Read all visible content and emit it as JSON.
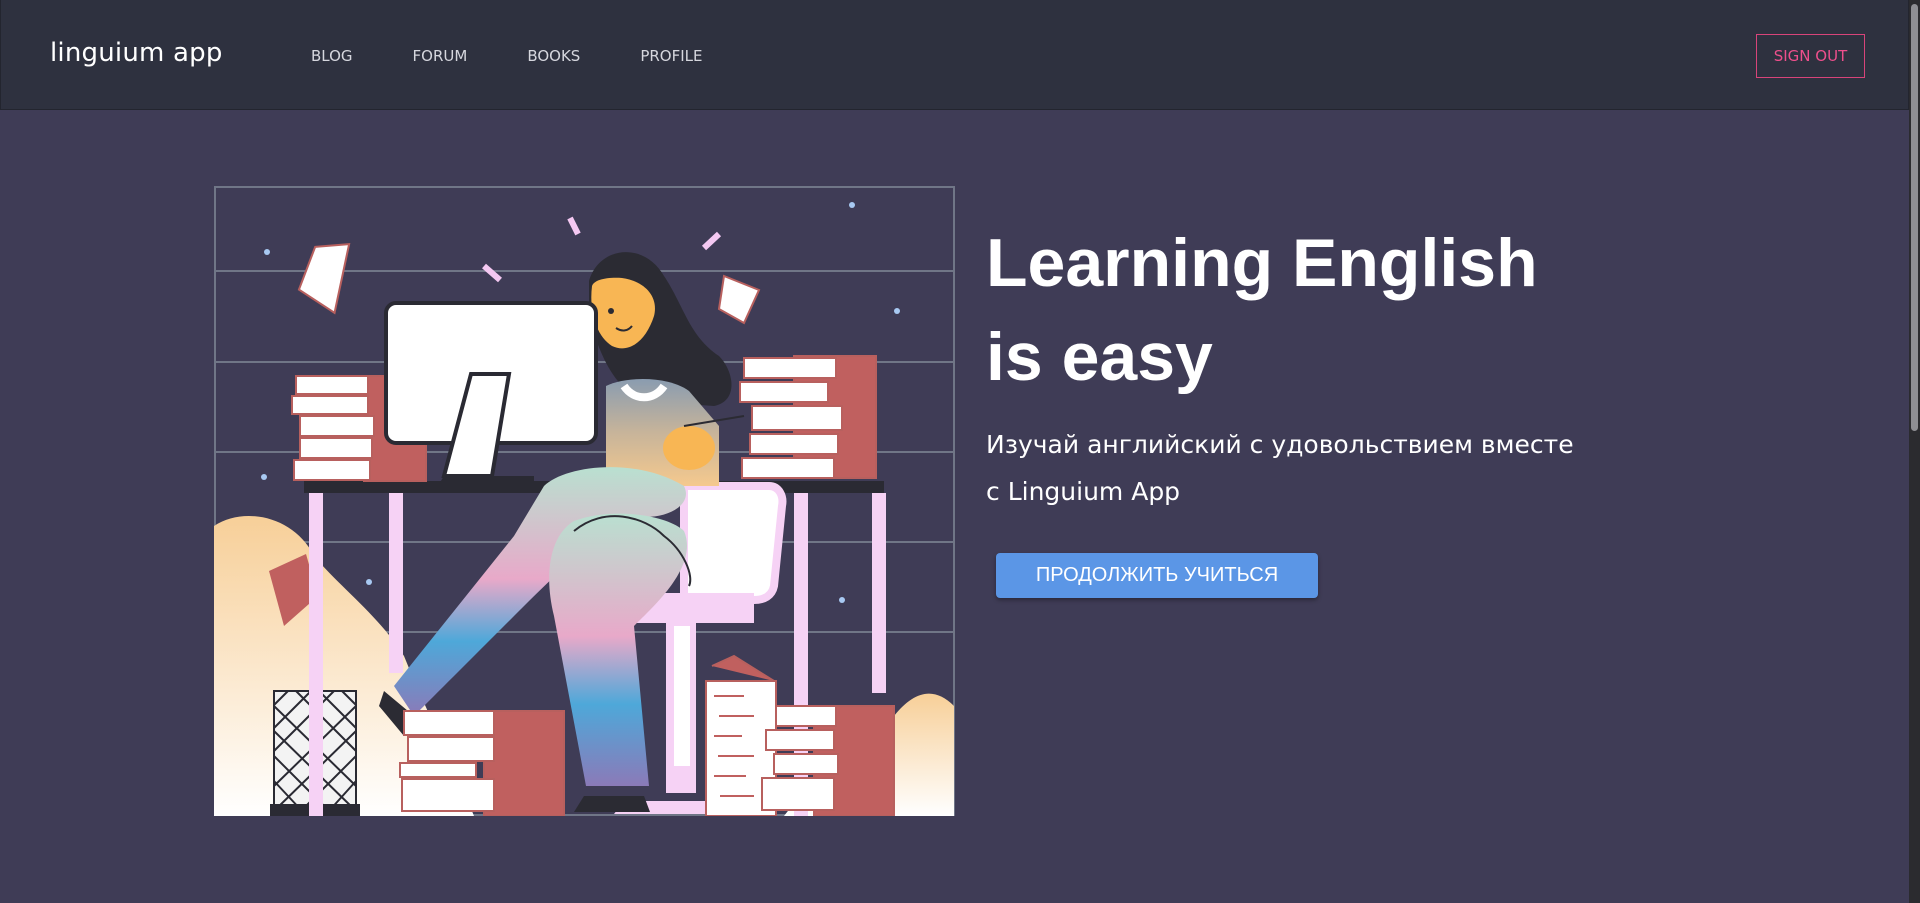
{
  "navbar": {
    "brand": "linguium app",
    "links": [
      {
        "label": "BLOG"
      },
      {
        "label": "FORUM"
      },
      {
        "label": "BOOKS"
      },
      {
        "label": "PROFILE"
      }
    ],
    "sign_out_label": "SIGN OUT"
  },
  "hero": {
    "title_line1": "Learning English",
    "title_line2": "is easy",
    "subtitle_line1": "Изучай английский с удовольствием вместе",
    "subtitle_line2": "с Linguium App",
    "cta_label": "ПРОДОЛЖИТЬ УЧИТЬСЯ",
    "illustration_icon": "woman-studying-at-desk-illustration"
  },
  "colors": {
    "page_bg": "#3f3c56",
    "navbar_bg": "#2e313f",
    "accent_pink": "#ee4f8c",
    "cta_blue": "#5b96e6"
  }
}
